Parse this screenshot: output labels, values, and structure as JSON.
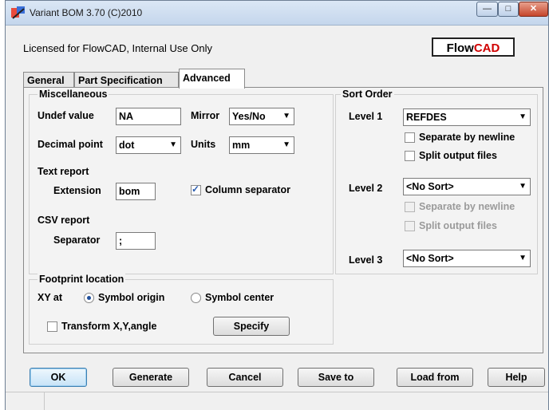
{
  "window": {
    "title": "Variant BOM 3.70 (C)2010"
  },
  "header": {
    "license_text": "Licensed for FlowCAD, Internal Use Only",
    "logo_part1": "Flow",
    "logo_part2": "CAD"
  },
  "tabs": [
    {
      "label": "General",
      "active": false
    },
    {
      "label": "Part Specification",
      "active": false
    },
    {
      "label": "Advanced",
      "active": true
    }
  ],
  "misc": {
    "title": "Miscellaneous",
    "undef_label": "Undef value",
    "undef_value": "NA",
    "mirror_label": "Mirror",
    "mirror_value": "Yes/No",
    "decimal_label": "Decimal point",
    "decimal_value": "dot",
    "units_label": "Units",
    "units_value": "mm",
    "text_report_label": "Text report",
    "extension_label": "Extension",
    "extension_value": "bom",
    "column_separator_label": "Column separator",
    "column_separator_checked": true,
    "csv_report_label": "CSV report",
    "separator_label": "Separator",
    "separator_value": ";"
  },
  "footprint": {
    "title": "Footprint location",
    "xy_label": "XY at",
    "origin_label": "Symbol origin",
    "origin_selected": true,
    "center_label": "Symbol center",
    "transform_label": "Transform X,Y,angle",
    "transform_checked": false,
    "specify_label": "Specify"
  },
  "sort": {
    "title": "Sort Order",
    "level1_label": "Level 1",
    "level1_value": "REFDES",
    "level1_newline_label": "Separate by newline",
    "level1_split_label": "Split output files",
    "level2_label": "Level 2",
    "level2_value": "<No Sort>",
    "level2_newline_label": "Separate by newline",
    "level2_split_label": "Split output files",
    "level3_label": "Level 3",
    "level3_value": "<No Sort>"
  },
  "buttons": {
    "ok": "OK",
    "generate": "Generate",
    "cancel": "Cancel",
    "save_to": "Save to",
    "load_from": "Load from",
    "help": "Help"
  },
  "icons": {
    "app": "variant-bom-icon",
    "dropdown": "chevron-down-icon",
    "check": "check-icon"
  },
  "colors": {
    "logo_red": "#d00000",
    "titlebar": "#c4d6ec",
    "close": "#c6462b"
  }
}
